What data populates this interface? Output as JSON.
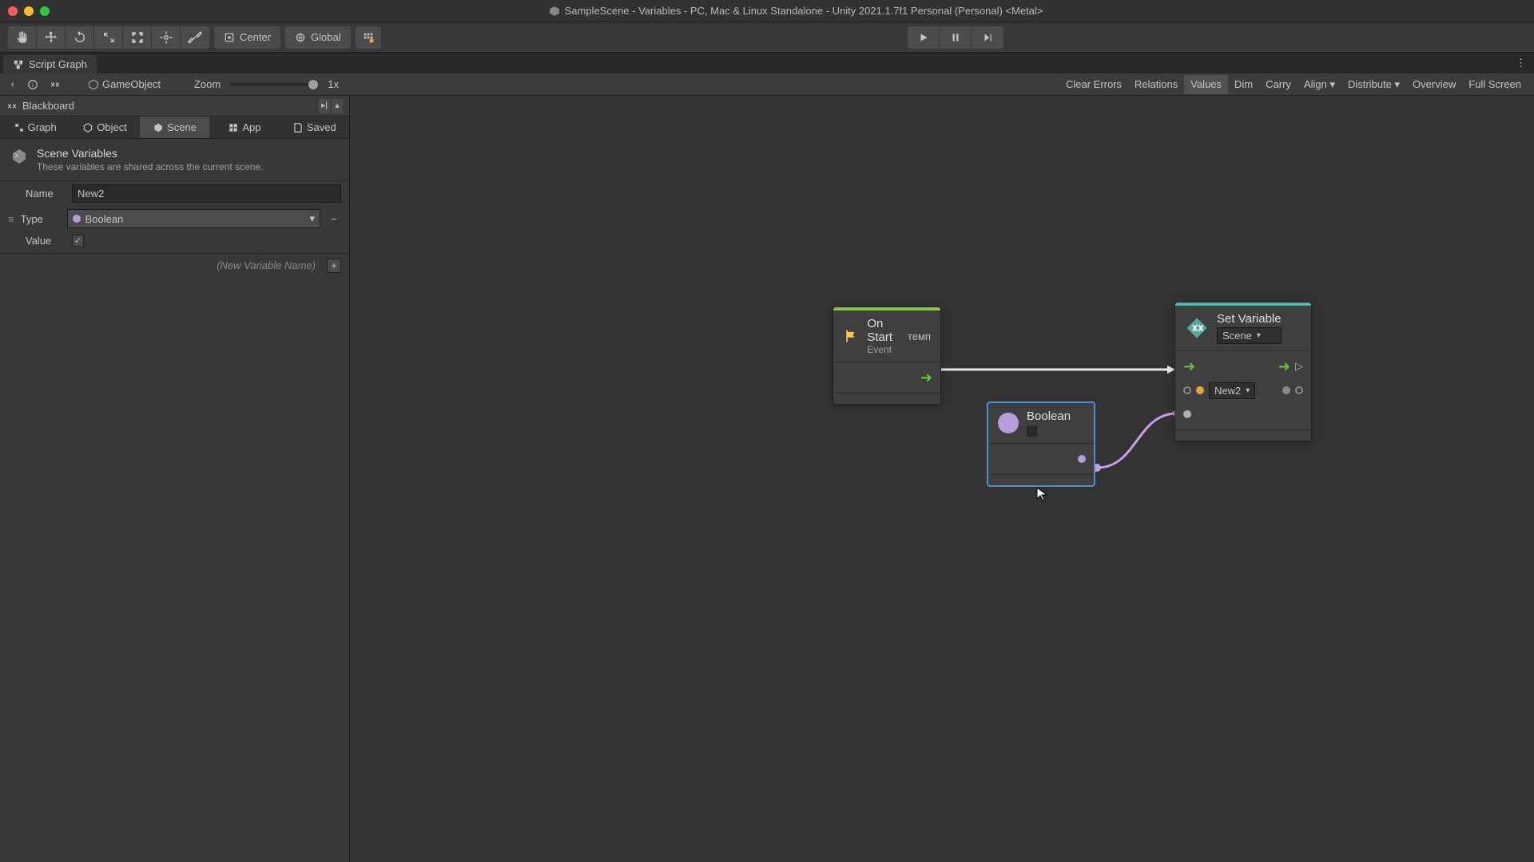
{
  "window": {
    "title": "SampleScene - Variables - PC, Mac & Linux Standalone - Unity 2021.1.7f1 Personal (Personal) <Metal>"
  },
  "toolbar": {
    "pivot_center": "Center",
    "pivot_global": "Global"
  },
  "tab": {
    "name": "Script Graph"
  },
  "graph_toolbar": {
    "gameobject": "GameObject",
    "zoom_label": "Zoom",
    "zoom_value": "1x",
    "buttons": {
      "clear_errors": "Clear Errors",
      "relations": "Relations",
      "values": "Values",
      "dim": "Dim",
      "carry": "Carry",
      "align": "Align",
      "distribute": "Distribute",
      "overview": "Overview",
      "fullscreen": "Full Screen"
    }
  },
  "blackboard": {
    "header": "Blackboard",
    "tabs": {
      "graph": "Graph",
      "object": "Object",
      "scene": "Scene",
      "app": "App",
      "saved": "Saved"
    },
    "desc": {
      "title": "Scene Variables",
      "sub": "These variables are shared across the current scene."
    },
    "var": {
      "name_label": "Name",
      "name_value": "New2",
      "type_label": "Type",
      "type_value": "Boolean",
      "value_label": "Value",
      "value_checked": true
    },
    "new_placeholder": "(New Variable Name)"
  },
  "nodes": {
    "onstart": {
      "title": "On Start",
      "subtitle": "Event"
    },
    "setvar": {
      "title": "Set Variable",
      "scope": "Scene",
      "var_name": "New2"
    },
    "boolean": {
      "title": "Boolean"
    }
  }
}
